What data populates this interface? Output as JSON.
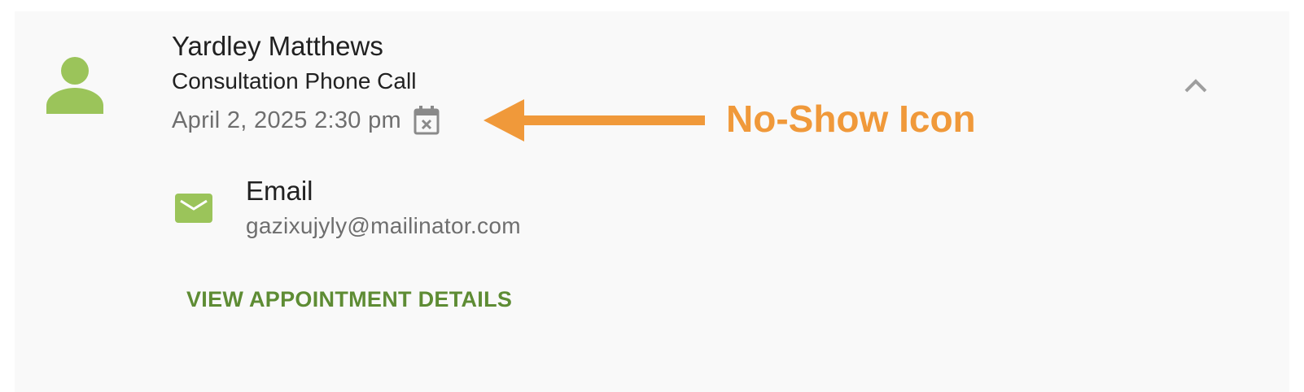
{
  "appointment": {
    "client_name": "Yardley Matthews",
    "service": "Consultation Phone Call",
    "datetime": "April 2, 2025 2:30 pm",
    "status_icon": "calendar-x-icon",
    "contact": {
      "label": "Email",
      "value": "gazixujyly@mailinator.com",
      "icon": "email-icon"
    },
    "details_button_label": "VIEW APPOINTMENT DETAILS",
    "collapse_icon": "chevron-up-icon",
    "avatar_icon": "person-icon"
  },
  "annotation": {
    "label": "No-Show Icon",
    "color": "#f0993a"
  },
  "colors": {
    "accent_green": "#9bc45a",
    "button_green": "#5e8c34",
    "card_background": "#f9f9f9"
  }
}
